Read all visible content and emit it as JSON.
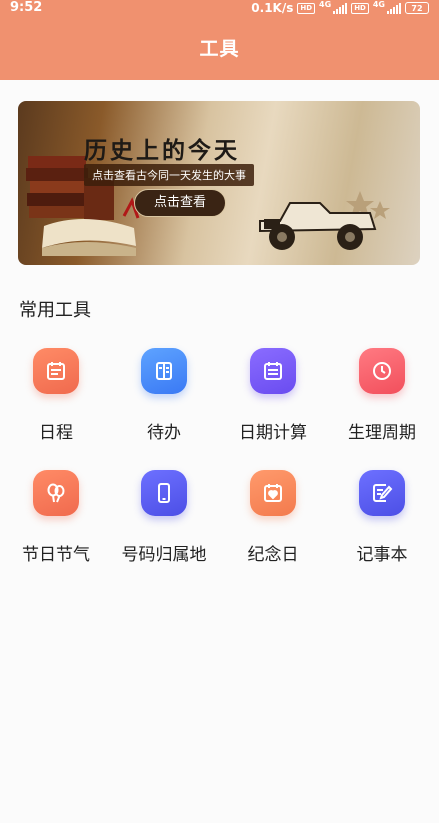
{
  "status_bar": {
    "time": "9:52",
    "speed": "0.1K/s",
    "hd1": "HD",
    "gen1": "4G",
    "hd2": "HD",
    "gen2": "4G",
    "battery": "72"
  },
  "header": {
    "title": "工具"
  },
  "banner": {
    "title": "历史上的今天",
    "subtitle": "点击查看古今同一天发生的大事",
    "button_label": "点击查看"
  },
  "section": {
    "title": "常用工具"
  },
  "tools": [
    {
      "label": "日程",
      "icon": "calendar-icon",
      "color": "#f47a5a"
    },
    {
      "label": "待办",
      "icon": "todo-list-icon",
      "color": "#4a8df8"
    },
    {
      "label": "日期计算",
      "icon": "date-calc-icon",
      "color": "#7b5cf7"
    },
    {
      "label": "生理周期",
      "icon": "clock-icon",
      "color": "#f45d6a"
    },
    {
      "label": "节日节气",
      "icon": "balloon-icon",
      "color": "#f47a5a"
    },
    {
      "label": "号码归属地",
      "icon": "phone-icon",
      "color": "#5c5ff0"
    },
    {
      "label": "纪念日",
      "icon": "heart-calendar-icon",
      "color": "#f5875a"
    },
    {
      "label": "记事本",
      "icon": "notepad-icon",
      "color": "#5c5ff0"
    }
  ]
}
